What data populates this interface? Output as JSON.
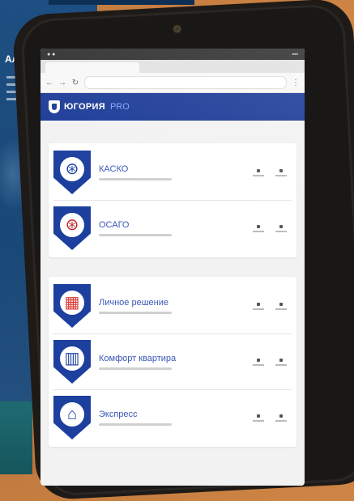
{
  "brand": {
    "name": "ЮГОРИЯ",
    "suffix": "PRO"
  },
  "products": [
    {
      "name": "КАСКО",
      "icon": "steering-wheel-icon",
      "color": "#1d3f9e",
      "glyph_color": "#1d3f9e"
    },
    {
      "name": "ОСАГО",
      "icon": "steering-wheel-icon",
      "color": "#1d3f9e",
      "glyph_color": "#c0262c"
    },
    {
      "name": "Личное решение",
      "icon": "building-icon",
      "color": "#1d3f9e",
      "glyph_color": "#d8342f"
    },
    {
      "name": "Комфорт квартира",
      "icon": "apartment-icon",
      "color": "#1d3f9e",
      "glyph_color": "#1d3f9e"
    },
    {
      "name": "Экспресс",
      "icon": "house-icon",
      "color": "#1d3f9e",
      "glyph_color": "#1d3f9e"
    }
  ],
  "colors": {
    "header": "#1b3a97",
    "accent": "#3a57b8",
    "background": "#c27a3f"
  }
}
